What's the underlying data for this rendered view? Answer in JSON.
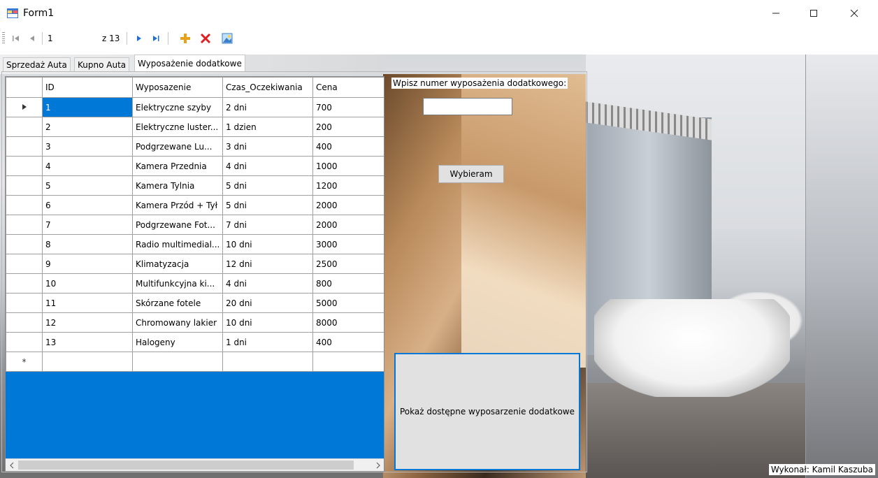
{
  "window": {
    "title": "Form1",
    "minimize": "—",
    "maximize": "☐",
    "close": "✕"
  },
  "navigator": {
    "position_value": "1",
    "count_label": "z 13"
  },
  "tabs": [
    {
      "label": "Sprzedaż Auta"
    },
    {
      "label": "Kupno Auta"
    },
    {
      "label": "Wyposażenie dodatkowe"
    }
  ],
  "grid": {
    "columns": [
      "ID",
      "Wyposazenie",
      "Czas_Oczekiwania",
      "Cena"
    ],
    "rows": [
      [
        "1",
        "Elektryczne szyby",
        "2 dni",
        "700"
      ],
      [
        "2",
        "Elektryczne luster...",
        "1 dzien",
        "200"
      ],
      [
        "3",
        "Podgrzewane Lu...",
        "3 dni",
        "400"
      ],
      [
        "4",
        "Kamera Przednia",
        "4 dni",
        "1000"
      ],
      [
        "5",
        "Kamera Tylnia",
        "5 dni",
        "1200"
      ],
      [
        "6",
        "Kamera Przód + Tył",
        "5 dni",
        "2000"
      ],
      [
        "7",
        "Podgrzewane Fot...",
        "7 dni",
        "2000"
      ],
      [
        "8",
        "Radio multimedial...",
        "10 dni",
        "3000"
      ],
      [
        "9",
        "Klimatyzacja",
        "12 dni",
        "2500"
      ],
      [
        "10",
        "Multifunkcyjna ki...",
        "4 dni",
        "800"
      ],
      [
        "11",
        "Skórzane fotele",
        "20 dni",
        "5000"
      ],
      [
        "12",
        "Chromowany lakier",
        "10 dni",
        "8000"
      ],
      [
        "13",
        "Halogeny",
        "1 dni",
        "400"
      ]
    ],
    "current_row_marker": "▶",
    "new_row_marker": "*"
  },
  "form": {
    "label": "Wpisz numer wyposażenia dodatkowego:",
    "input_value": "",
    "select_button": "Wybieram",
    "show_button": "Pokaż dostępne wyposarzenie dodatkowe"
  },
  "footer": {
    "author": "Wykonał: Kamil Kaszuba"
  },
  "colors": {
    "selection": "#0078d7",
    "grid_background": "#0078d7",
    "add_icon": "#e8a21a",
    "delete_icon": "#e02020"
  }
}
